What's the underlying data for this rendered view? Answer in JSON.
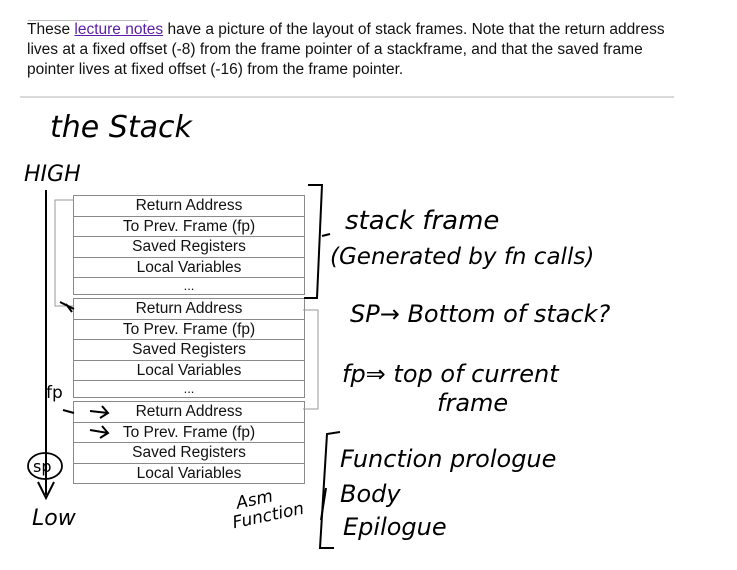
{
  "paragraph": {
    "before_link": "These ",
    "link_text": "lecture notes",
    "after_link": " have a picture of the layout of stack frames. Note that the return address lives at a fixed offset (-8) from the frame pointer of a stackframe, and that the saved frame pointer lives at fixed offset (-16) from the frame pointer."
  },
  "diagram": {
    "title": "the Stack",
    "high_label": "HIGH",
    "low_label": "Low",
    "fp_label": "fp",
    "sp_label": "sp",
    "frames": [
      {
        "rows": [
          "Return Address",
          "To Prev. Frame (fp)",
          "Saved Registers",
          "Local Variables",
          "..."
        ]
      },
      {
        "rows": [
          "Return Address",
          "To Prev. Frame (fp)",
          "Saved Registers",
          "Local Variables",
          "..."
        ]
      },
      {
        "rows": [
          "Return Address",
          "To Prev. Frame (fp)",
          "Saved Registers",
          "Local Variables"
        ]
      }
    ],
    "notes": {
      "stack_frame": "stack frame",
      "generated": "(Generated by fn calls)",
      "sp_note": "SP→ Bottom of stack?",
      "fp_note": "fp⇒ top of current",
      "fp_note2": "frame",
      "prologue": "Function prologue",
      "body": "Body",
      "epilogue": "Epilogue",
      "asm": "Asm",
      "function": "Function"
    }
  }
}
